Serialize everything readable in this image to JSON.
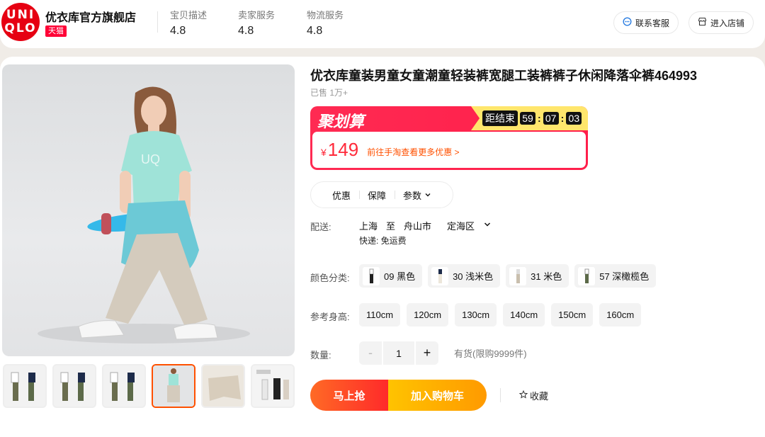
{
  "shop": {
    "logo_text": "UNI QLO",
    "name": "优衣库官方旗舰店",
    "badge": "天猫",
    "ratings": [
      {
        "label": "宝贝描述",
        "value": "4.8"
      },
      {
        "label": "卖家服务",
        "value": "4.8"
      },
      {
        "label": "物流服务",
        "value": "4.8"
      }
    ],
    "service_button": "联系客服",
    "enter_shop_button": "进入店铺"
  },
  "product": {
    "title": "优衣库童装男童女童潮童轻装裤宽腿工装裤裤子休闲降落伞裤464993",
    "sold": "已售 1万+",
    "promo": {
      "title": "聚划算",
      "countdown_label": "距结束",
      "hours": "59",
      "minutes": "07",
      "seconds": "03",
      "currency": "¥",
      "price": "149",
      "link": "前往手淘查看更多优惠 >"
    },
    "tabs": [
      "优惠",
      "保障",
      "参数"
    ],
    "shipping": {
      "label": "配送:",
      "from": "上海",
      "to_word": "至",
      "city": "舟山市",
      "district": "定海区",
      "fee": "快递: 免运费"
    },
    "color": {
      "label": "颜色分类:",
      "options": [
        "09 黑色",
        "30 浅米色",
        "31 米色",
        "57 深橄榄色"
      ]
    },
    "size": {
      "label": "参考身高:",
      "options": [
        "110cm",
        "120cm",
        "130cm",
        "140cm",
        "150cm",
        "160cm"
      ]
    },
    "quantity": {
      "label": "数量:",
      "value": "1",
      "minus": "-",
      "plus": "+",
      "stock": "有货(限购9999件)"
    },
    "buttons": {
      "buy_now": "马上抢",
      "add_to_cart": "加入购物车",
      "favorite": "收藏"
    }
  },
  "colors": {
    "brand_red": "#e60012",
    "tmall_red": "#ff0036",
    "promo_red": "#ff2a52",
    "price_red": "#ff2a3a",
    "accent_orange": "#ff5000",
    "countdown_yellow": "#ffe66c"
  }
}
